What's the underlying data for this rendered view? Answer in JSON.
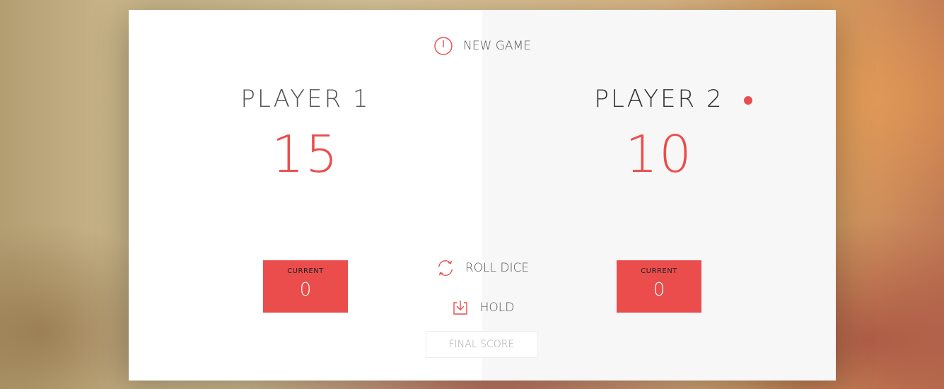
{
  "buttons": {
    "new_game": "NEW GAME",
    "roll_dice": "ROLL DICE",
    "hold": "HOLD"
  },
  "players": [
    {
      "name": "PLAYER 1",
      "score": "15",
      "current_label": "CURRENT",
      "current_score": "0",
      "active": false
    },
    {
      "name": "PLAYER 2",
      "score": "10",
      "current_label": "CURRENT",
      "current_score": "0",
      "active": true
    }
  ],
  "final_score": {
    "placeholder": "FINAL SCORE",
    "value": ""
  },
  "icons": {
    "new_game": "power-icon",
    "roll_dice": "refresh-icon",
    "hold": "download-icon"
  },
  "colors": {
    "accent": "#eb4d4d",
    "panel_left": "#ffffff",
    "panel_right": "#f7f7f7"
  }
}
